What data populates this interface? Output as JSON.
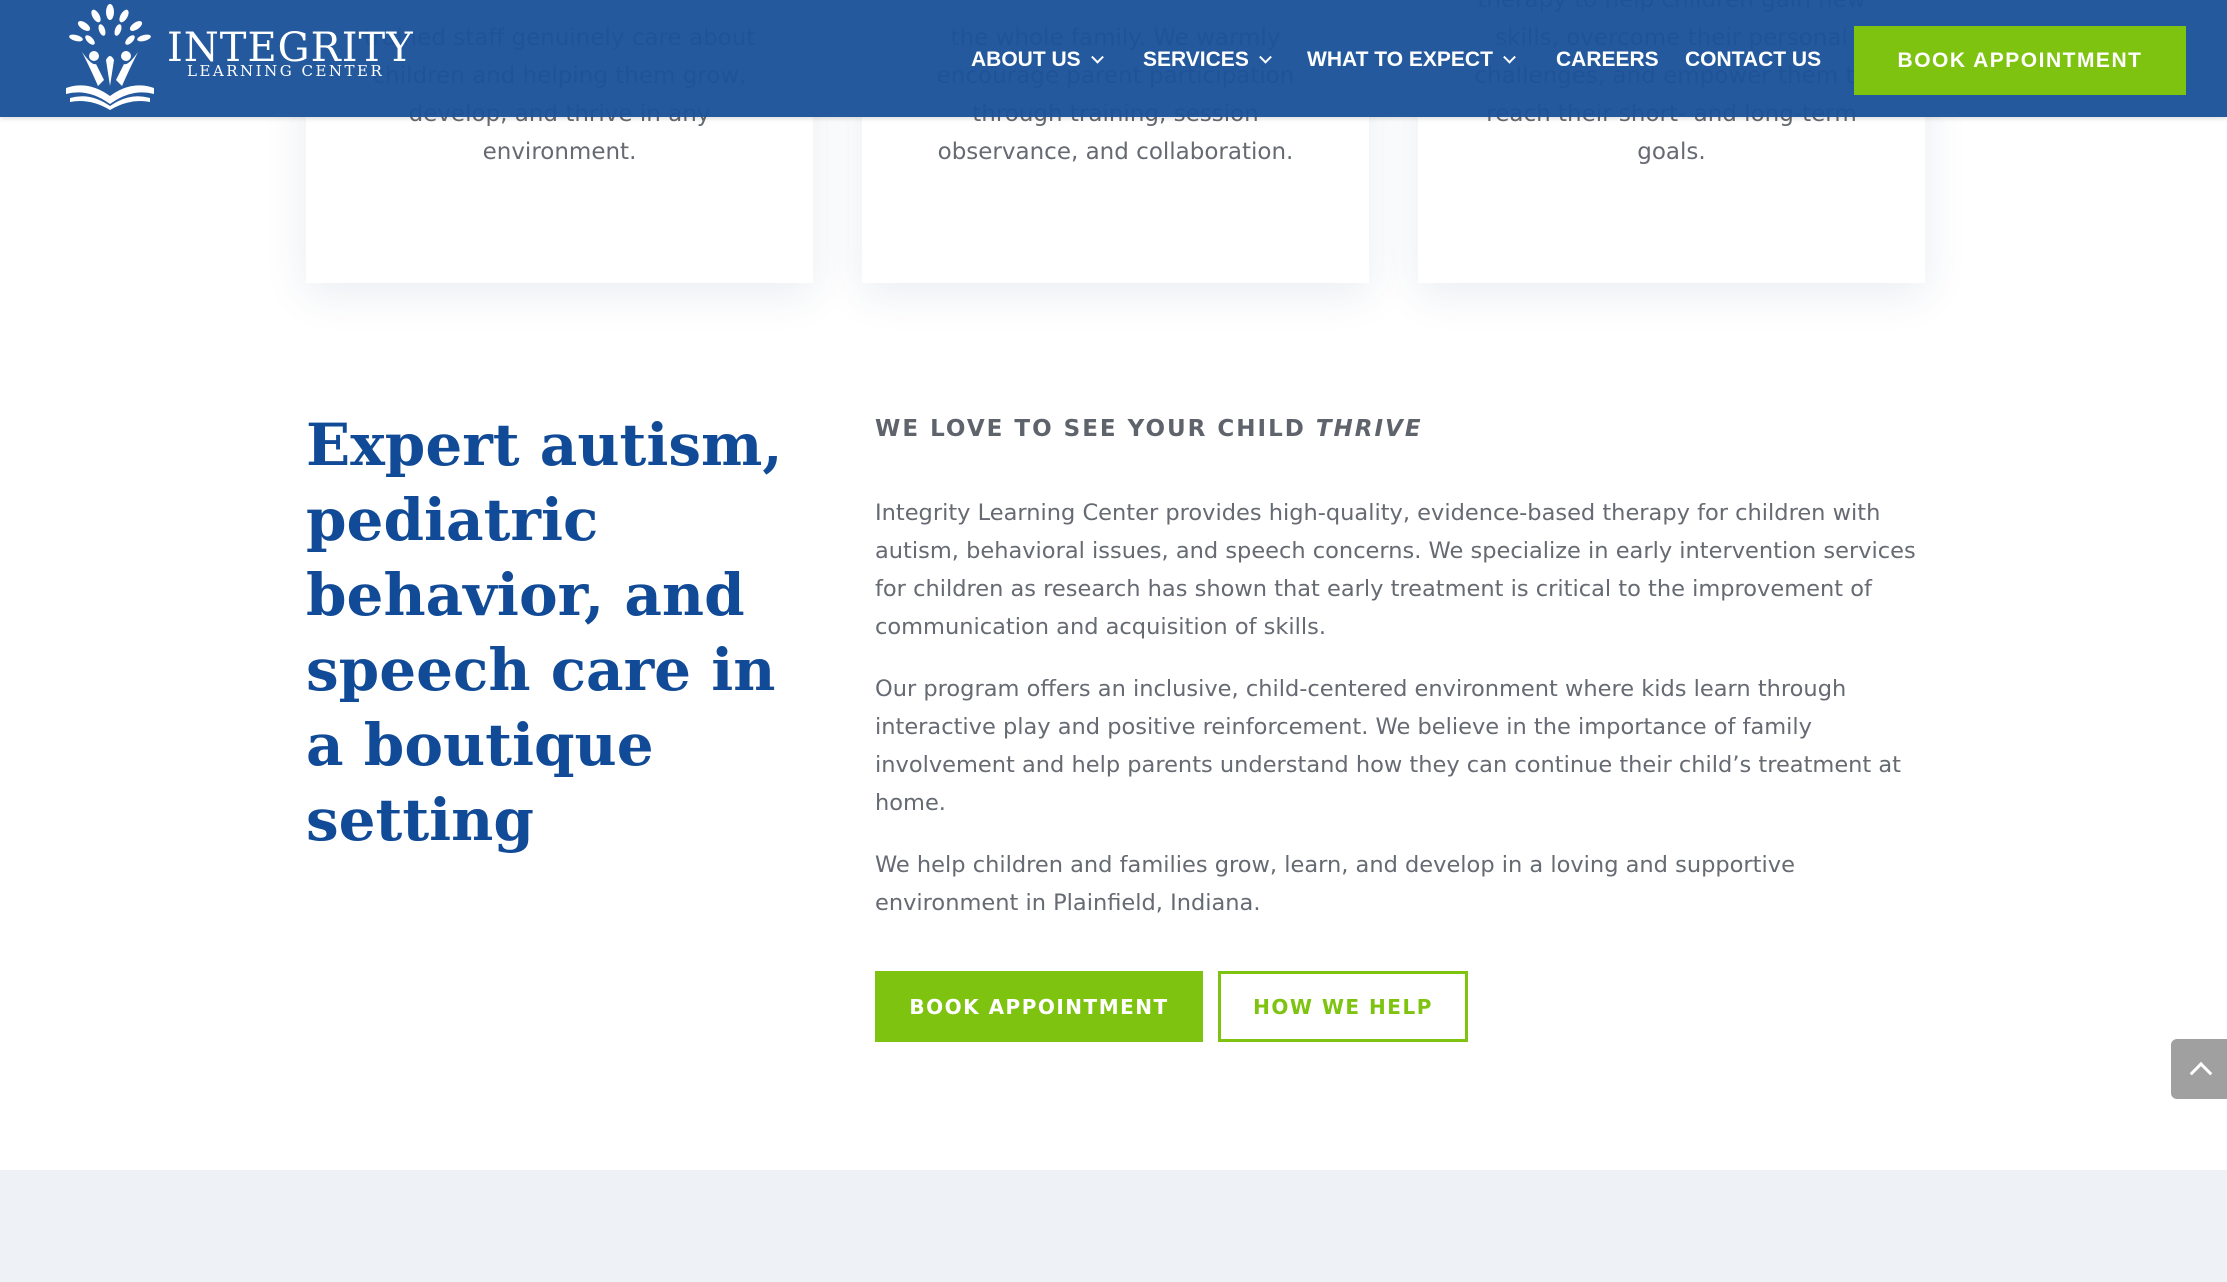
{
  "header": {
    "logo": {
      "wordmark": "INTEGRITY",
      "subtitle": "LEARNING CENTER",
      "icon": "tree-book-children-logo-icon"
    },
    "nav": [
      {
        "label": "ABOUT US",
        "has_dropdown": true,
        "icon": "chevron-down-icon"
      },
      {
        "label": "SERVICES",
        "has_dropdown": true,
        "icon": "chevron-down-icon"
      },
      {
        "label": "WHAT TO EXPECT",
        "has_dropdown": true,
        "icon": "chevron-down-icon"
      },
      {
        "label": "CAREERS",
        "has_dropdown": false
      },
      {
        "label": "CONTACT US",
        "has_dropdown": false
      }
    ],
    "cta_label": "BOOK APPOINTMENT"
  },
  "cards": [
    {
      "text": "trained staff genuinely care about children and helping them grow, develop, and thrive in any environment."
    },
    {
      "text": "the whole family. We warmly encourage parent participation through training, session observance, and collaboration."
    },
    {
      "text": "therapy to help children gain new skills, overcome their personal challenges, and empower them to reach their short- and long-term goals."
    }
  ],
  "main": {
    "headline": "Expert autism, pediatric behavior, and speech care in a boutique setting",
    "subtitle_prefix": "WE LOVE TO SEE YOUR CHILD ",
    "subtitle_emphasis": "THRIVE",
    "paragraphs": [
      "Integrity Learning Center provides high-quality, evidence-based therapy for children with autism, behavioral issues, and speech concerns. We specialize in early intervention services for children as research has shown that early treatment is critical to the improvement of communication and acquisition of skills.",
      "Our program offers an inclusive, child-centered environment where kids learn through interactive play and positive reinforcement. We believe in the importance of family involvement and help parents understand how they can continue their child’s treatment at home.",
      "We help children and families grow, learn, and develop in a loving and supportive environment in Plainfield, Indiana."
    ],
    "buttons": {
      "primary": "BOOK APPOINTMENT",
      "secondary": "HOW WE HELP"
    }
  },
  "scroll_top": {
    "icon": "chevron-up-icon"
  },
  "colors": {
    "header_bg": "#1b5399",
    "accent_green": "#7dc30f",
    "headline_blue": "#114a96",
    "body_text": "#666a72",
    "section_gray": "#eef1f5",
    "scroll_top_bg": "#a0a0a0"
  }
}
